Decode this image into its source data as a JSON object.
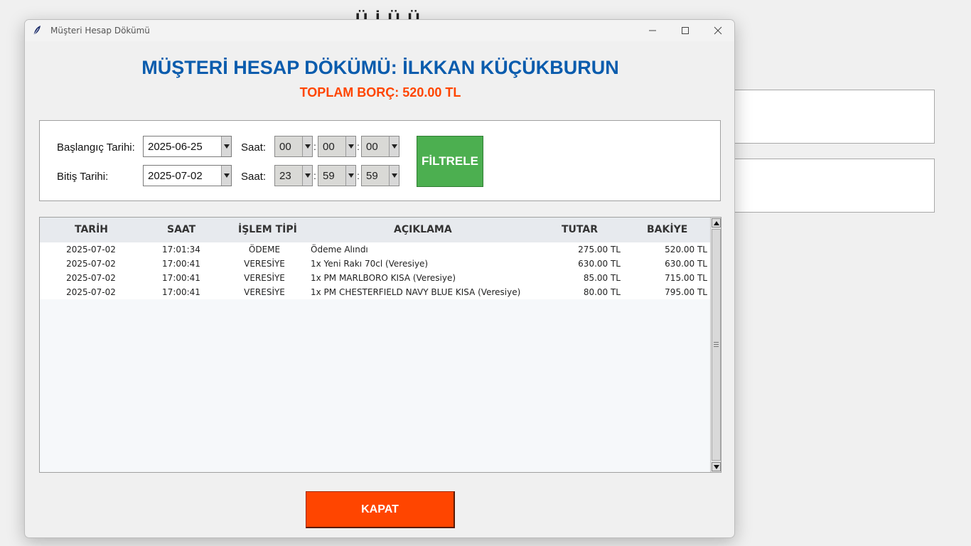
{
  "window": {
    "title": "Müşteri Hesap Dökümü"
  },
  "header": {
    "title": "MÜŞTERİ HESAP DÖKÜMÜ: İLKKAN KÜÇÜKBURUN",
    "total": "TOPLAM BORÇ: 520.00 TL"
  },
  "colors": {
    "title": "#0b5cad",
    "total": "#ff4500",
    "filter_button": "#4caf50",
    "close_button": "#ff4500"
  },
  "filter": {
    "start_label": "Başlangıç Tarihi:",
    "start_date": "2025-06-25",
    "end_label": "Bitiş Tarihi:",
    "end_date": "2025-07-02",
    "time_label": "Saat:",
    "start_time": {
      "hour": "00",
      "minute": "00",
      "second": "00"
    },
    "end_time": {
      "hour": "23",
      "minute": "59",
      "second": "59"
    },
    "time_separator": ":",
    "button_label": "FİLTRELE"
  },
  "table": {
    "columns": [
      "TARİH",
      "SAAT",
      "İŞLEM TİPİ",
      "AÇIKLAMA",
      "TUTAR",
      "BAKİYE"
    ],
    "rows": [
      [
        "2025-07-02",
        "17:01:34",
        "ÖDEME",
        "Ödeme Alındı",
        "275.00 TL",
        "520.00 TL"
      ],
      [
        "2025-07-02",
        "17:00:41",
        "VERESİYE",
        "1x Yeni Rakı 70cl (Veresiye)",
        "630.00 TL",
        "630.00 TL"
      ],
      [
        "2025-07-02",
        "17:00:41",
        "VERESİYE",
        "1x PM MARLBORO KISA (Veresiye)",
        "85.00 TL",
        "715.00 TL"
      ],
      [
        "2025-07-02",
        "17:00:41",
        "VERESİYE",
        "1x PM CHESTERFIELD NAVY BLUE KISA (Veresiye)",
        "80.00 TL",
        "795.00 TL"
      ]
    ]
  },
  "footer": {
    "close_label": "KAPAT"
  }
}
